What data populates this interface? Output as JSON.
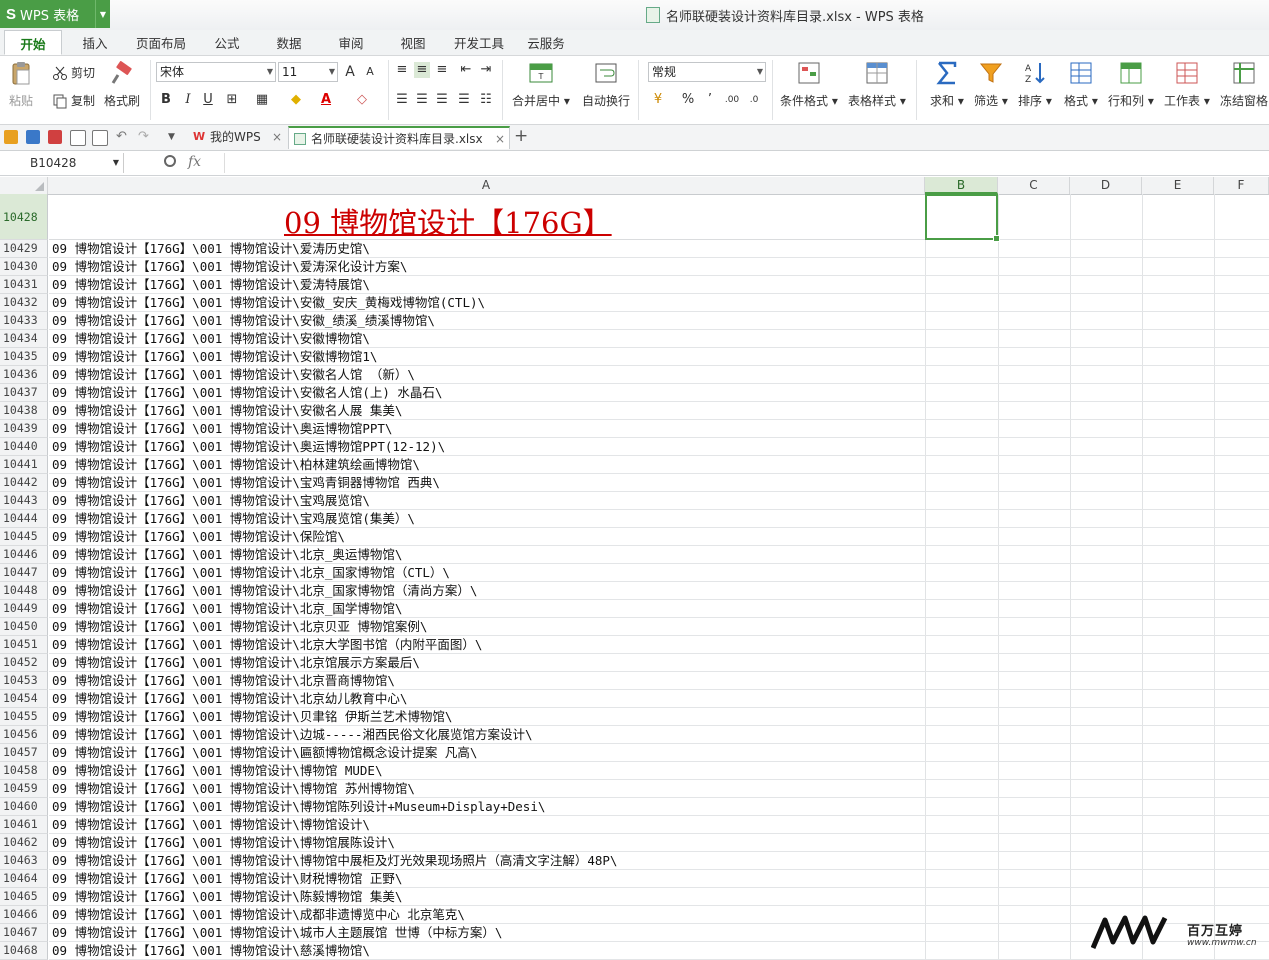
{
  "app": {
    "name": "WPS 表格",
    "logo": "S",
    "window_title": "名师联硬装设计资料库目录.xlsx - WPS 表格"
  },
  "menu_tabs": [
    "开始",
    "插入",
    "页面布局",
    "公式",
    "数据",
    "审阅",
    "视图",
    "开发工具",
    "云服务"
  ],
  "ribbon": {
    "paste": "粘贴",
    "cut": "剪切",
    "copy": "复制",
    "format_painter": "格式刷",
    "font_name": "宋体",
    "font_size": "11",
    "bold": "B",
    "italic": "I",
    "underline": "U",
    "merge_center": "合并居中",
    "wrap_text": "自动换行",
    "number_format": "常规",
    "percent": "%",
    "comma": "’",
    "cond_format": "条件格式",
    "table_style": "表格样式",
    "sum": "求和",
    "filter": "筛选",
    "sort": "排序",
    "format": "格式",
    "row_col": "行和列",
    "worksheet": "工作表",
    "freeze": "冻结窗格"
  },
  "doc_tabs": [
    {
      "label": "我的WPS",
      "active": false
    },
    {
      "label": "名师联硬装设计资料库目录.xlsx",
      "active": true
    }
  ],
  "add_tab": "+",
  "formula_bar": {
    "name_box": "B10428",
    "fx": "fx",
    "content": ""
  },
  "columns": [
    "A",
    "B",
    "C",
    "D",
    "E",
    "F"
  ],
  "selected_column": "B",
  "title_row": {
    "row": "10428",
    "text": "09 博物馆设计【176G】"
  },
  "rows": [
    {
      "n": "10429",
      "a": "09 博物馆设计【176G】\\001 博物馆设计\\爱涛历史馆\\"
    },
    {
      "n": "10430",
      "a": "09 博物馆设计【176G】\\001 博物馆设计\\爱涛深化设计方案\\"
    },
    {
      "n": "10431",
      "a": "09 博物馆设计【176G】\\001 博物馆设计\\爱涛特展馆\\"
    },
    {
      "n": "10432",
      "a": "09 博物馆设计【176G】\\001 博物馆设计\\安徽_安庆_黄梅戏博物馆(CTL)\\"
    },
    {
      "n": "10433",
      "a": "09 博物馆设计【176G】\\001 博物馆设计\\安徽_绩溪_绩溪博物馆\\"
    },
    {
      "n": "10434",
      "a": "09 博物馆设计【176G】\\001 博物馆设计\\安徽博物馆\\"
    },
    {
      "n": "10435",
      "a": "09 博物馆设计【176G】\\001 博物馆设计\\安徽博物馆1\\"
    },
    {
      "n": "10436",
      "a": "09 博物馆设计【176G】\\001 博物馆设计\\安徽名人馆 （新）\\"
    },
    {
      "n": "10437",
      "a": "09 博物馆设计【176G】\\001 博物馆设计\\安徽名人馆(上) 水晶石\\"
    },
    {
      "n": "10438",
      "a": "09 博物馆设计【176G】\\001 博物馆设计\\安徽名人展 集美\\"
    },
    {
      "n": "10439",
      "a": "09 博物馆设计【176G】\\001 博物馆设计\\奥运博物馆PPT\\"
    },
    {
      "n": "10440",
      "a": "09 博物馆设计【176G】\\001 博物馆设计\\奥运博物馆PPT(12-12)\\"
    },
    {
      "n": "10441",
      "a": "09 博物馆设计【176G】\\001 博物馆设计\\柏林建筑绘画博物馆\\"
    },
    {
      "n": "10442",
      "a": "09 博物馆设计【176G】\\001 博物馆设计\\宝鸡青铜器博物馆 西典\\"
    },
    {
      "n": "10443",
      "a": "09 博物馆设计【176G】\\001 博物馆设计\\宝鸡展览馆\\"
    },
    {
      "n": "10444",
      "a": "09 博物馆设计【176G】\\001 博物馆设计\\宝鸡展览馆(集美）\\"
    },
    {
      "n": "10445",
      "a": "09 博物馆设计【176G】\\001 博物馆设计\\保险馆\\"
    },
    {
      "n": "10446",
      "a": "09 博物馆设计【176G】\\001 博物馆设计\\北京_奥运博物馆\\"
    },
    {
      "n": "10447",
      "a": "09 博物馆设计【176G】\\001 博物馆设计\\北京_国家博物馆（CTL）\\"
    },
    {
      "n": "10448",
      "a": "09 博物馆设计【176G】\\001 博物馆设计\\北京_国家博物馆（清尚方案）\\"
    },
    {
      "n": "10449",
      "a": "09 博物馆设计【176G】\\001 博物馆设计\\北京_国学博物馆\\"
    },
    {
      "n": "10450",
      "a": "09 博物馆设计【176G】\\001 博物馆设计\\北京贝亚 博物馆案例\\"
    },
    {
      "n": "10451",
      "a": "09 博物馆设计【176G】\\001 博物馆设计\\北京大学图书馆（内附平面图）\\"
    },
    {
      "n": "10452",
      "a": "09 博物馆设计【176G】\\001 博物馆设计\\北京馆展示方案最后\\"
    },
    {
      "n": "10453",
      "a": "09 博物馆设计【176G】\\001 博物馆设计\\北京晋商博物馆\\"
    },
    {
      "n": "10454",
      "a": "09 博物馆设计【176G】\\001 博物馆设计\\北京幼儿教育中心\\"
    },
    {
      "n": "10455",
      "a": "09 博物馆设计【176G】\\001 博物馆设计\\贝聿铭 伊斯兰艺术博物馆\\"
    },
    {
      "n": "10456",
      "a": "09 博物馆设计【176G】\\001 博物馆设计\\边城-----湘西民俗文化展览馆方案设计\\"
    },
    {
      "n": "10457",
      "a": "09 博物馆设计【176G】\\001 博物馆设计\\匾额博物馆概念设计提案 凡高\\"
    },
    {
      "n": "10458",
      "a": "09 博物馆设计【176G】\\001 博物馆设计\\博物馆 MUDE\\"
    },
    {
      "n": "10459",
      "a": "09 博物馆设计【176G】\\001 博物馆设计\\博物馆 苏州博物馆\\"
    },
    {
      "n": "10460",
      "a": "09 博物馆设计【176G】\\001 博物馆设计\\博物馆陈列设计+Museum+Display+Desi\\"
    },
    {
      "n": "10461",
      "a": "09 博物馆设计【176G】\\001 博物馆设计\\博物馆设计\\"
    },
    {
      "n": "10462",
      "a": "09 博物馆设计【176G】\\001 博物馆设计\\博物馆展陈设计\\"
    },
    {
      "n": "10463",
      "a": "09 博物馆设计【176G】\\001 博物馆设计\\博物馆中展柜及灯光效果现场照片（高清文字注解）48P\\"
    },
    {
      "n": "10464",
      "a": "09 博物馆设计【176G】\\001 博物馆设计\\财税博物馆 正野\\"
    },
    {
      "n": "10465",
      "a": "09 博物馆设计【176G】\\001 博物馆设计\\陈毅博物馆 集美\\"
    },
    {
      "n": "10466",
      "a": "09 博物馆设计【176G】\\001 博物馆设计\\成都非遗博览中心 北京笔克\\"
    },
    {
      "n": "10467",
      "a": "09 博物馆设计【176G】\\001 博物馆设计\\城市人主题展馆 世博（中标方案）\\"
    },
    {
      "n": "10468",
      "a": "09 博物馆设计【176G】\\001 博物馆设计\\慈溪博物馆\\"
    }
  ],
  "watermark": {
    "name": "百万互婷",
    "url": "www.mwmw.cn"
  },
  "colors": {
    "accent": "#4a9d46",
    "title_red": "#cc0000"
  }
}
